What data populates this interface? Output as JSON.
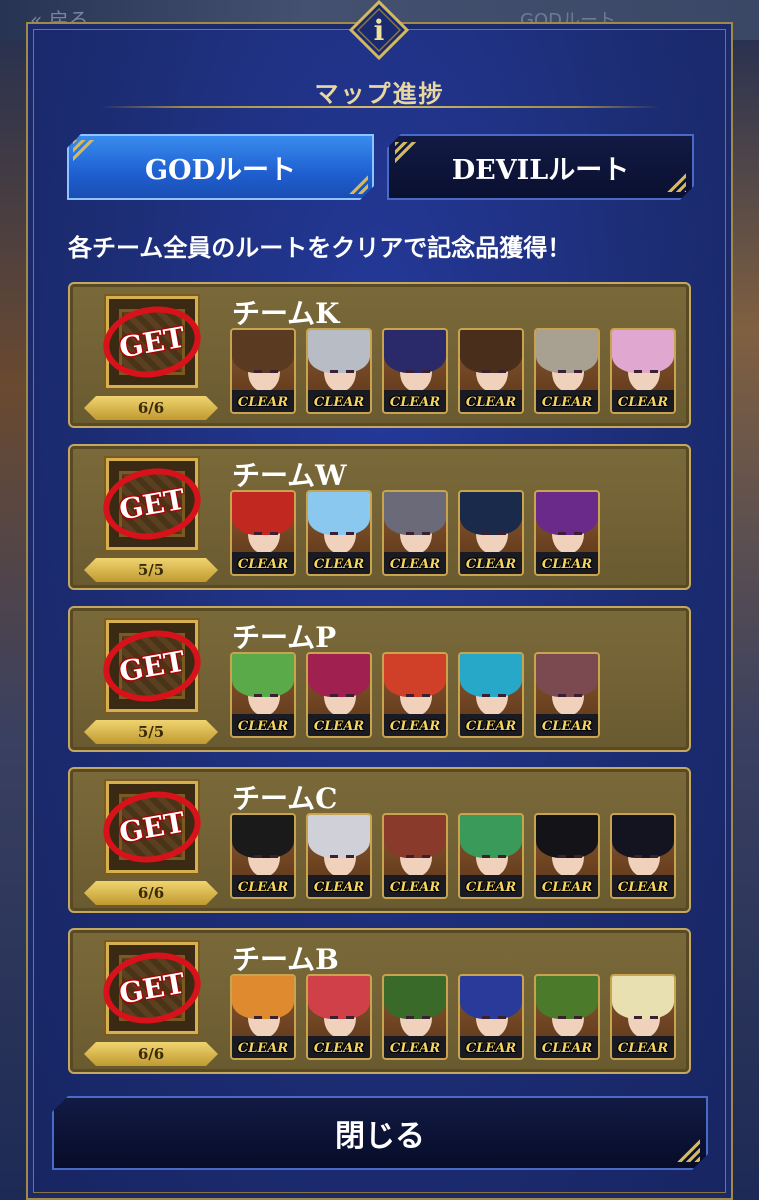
{
  "background": {
    "back_label": "« 戻る",
    "tab_label": "GODルート"
  },
  "header": {
    "icon": "info-icon",
    "title": "マップ進捗"
  },
  "tabs": [
    {
      "label": "GODルート",
      "selected": true
    },
    {
      "label": "DEVILルート",
      "selected": false
    }
  ],
  "notice": "各チーム全員のルートをクリアで記念品獲得！",
  "reward_stamp": "GET",
  "clear_label": "CLEAR",
  "teams": [
    {
      "name": "チームK",
      "progress": "6/6",
      "members": [
        {
          "hair": "#5a3a20"
        },
        {
          "hair": "#b8bcc4"
        },
        {
          "hair": "#2a2a6a"
        },
        {
          "hair": "#4a2e1c"
        },
        {
          "hair": "#a8a090"
        },
        {
          "hair": "#e0a8d0"
        }
      ]
    },
    {
      "name": "チームW",
      "progress": "5/5",
      "members": [
        {
          "hair": "#c02820"
        },
        {
          "hair": "#8ac8f0"
        },
        {
          "hair": "#6a6a78"
        },
        {
          "hair": "#1a2a4a"
        },
        {
          "hair": "#6a2a8a"
        }
      ]
    },
    {
      "name": "チームP",
      "progress": "5/5",
      "members": [
        {
          "hair": "#5aaa4a"
        },
        {
          "hair": "#a02050"
        },
        {
          "hair": "#d04028"
        },
        {
          "hair": "#28a8c8"
        },
        {
          "hair": "#7a4a50"
        }
      ]
    },
    {
      "name": "チームC",
      "progress": "6/6",
      "members": [
        {
          "hair": "#1a1a1a"
        },
        {
          "hair": "#d0d0d8"
        },
        {
          "hair": "#8a3a2a"
        },
        {
          "hair": "#3a9a5a"
        },
        {
          "hair": "#141418"
        },
        {
          "hair": "#141420"
        }
      ]
    },
    {
      "name": "チームB",
      "progress": "6/6",
      "members": [
        {
          "hair": "#e08a30"
        },
        {
          "hair": "#d04048"
        },
        {
          "hair": "#3a6a2a"
        },
        {
          "hair": "#2a3a9a"
        },
        {
          "hair": "#4a7a2a"
        },
        {
          "hair": "#e8e0b0"
        }
      ]
    }
  ],
  "close_button": "閉じる",
  "colors": {
    "panel": "#1e2e78",
    "gold": "#c4a860",
    "selected_tab": "#1f5fd0",
    "stamp_red": "#d8121a",
    "clear_text": "#f4d460"
  }
}
